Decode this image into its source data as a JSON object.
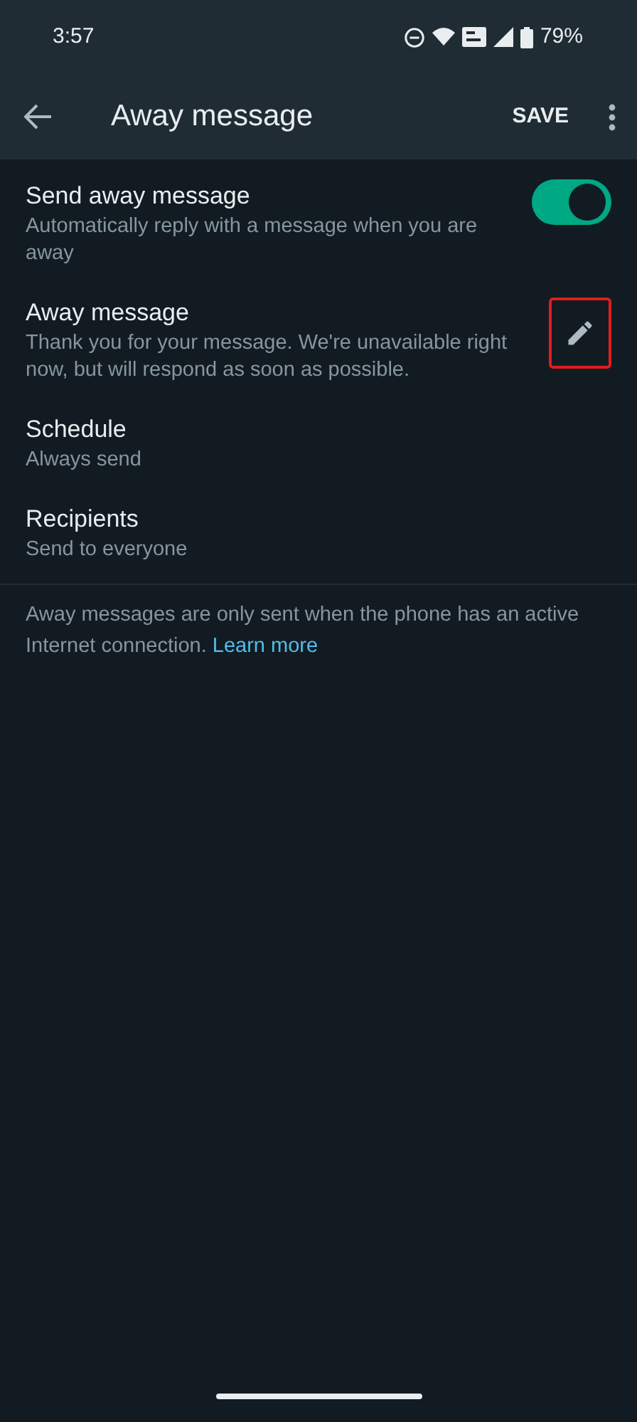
{
  "status_bar": {
    "time": "3:57",
    "battery": "79%"
  },
  "app_bar": {
    "title": "Away message",
    "action": "SAVE"
  },
  "settings": [
    {
      "kind": "toggle",
      "title": "Send away message",
      "subtitle": "Automatically reply with a message when you are away",
      "on": true
    },
    {
      "kind": "edit",
      "title": "Away message",
      "subtitle": "Thank you for your message. We're unavailable right now, but will respond as soon as possible.",
      "highlighted": true
    },
    {
      "kind": "plain",
      "title": "Schedule",
      "subtitle": "Always send"
    },
    {
      "kind": "plain",
      "title": "Recipients",
      "subtitle": "Send to everyone"
    }
  ],
  "footer": {
    "text": "Away messages are only sent when the phone has an active Internet connection.",
    "link": "Learn more"
  }
}
